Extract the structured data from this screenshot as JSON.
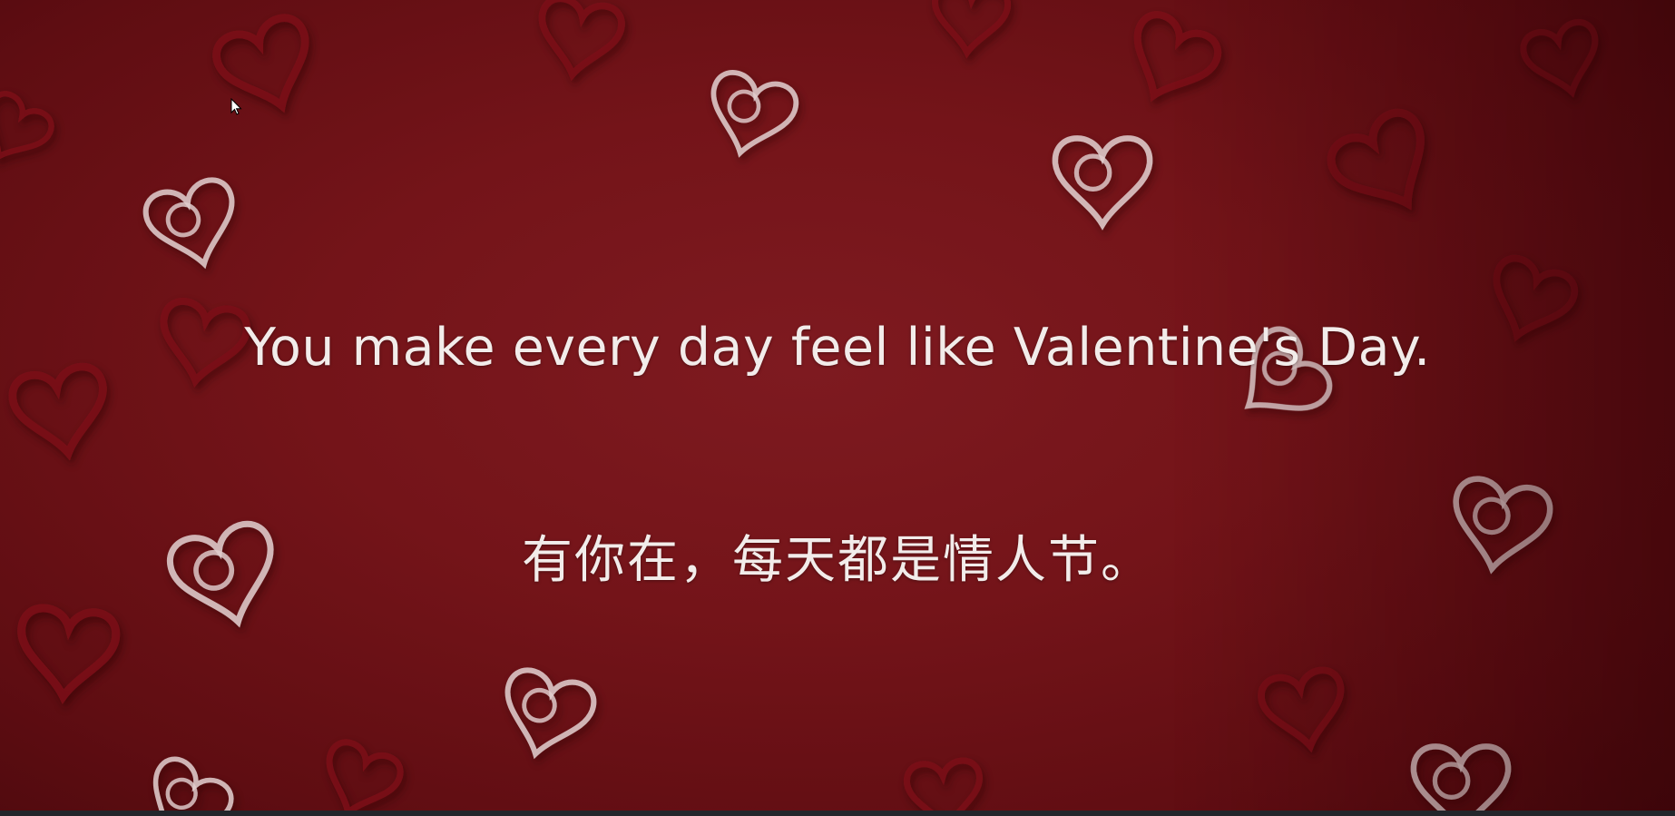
{
  "slide": {
    "text_english": "You make every day feel like Valentine's Day.",
    "text_chinese": "有你在，每天都是情人节。",
    "background_color": "#741419",
    "text_color": "#f2ecea",
    "decoration_icon": "paper-heart-icon",
    "decoration_colors": [
      "#e2cfcf",
      "#7a1319"
    ]
  },
  "pointer": {
    "icon": "mouse-pointer-icon"
  }
}
